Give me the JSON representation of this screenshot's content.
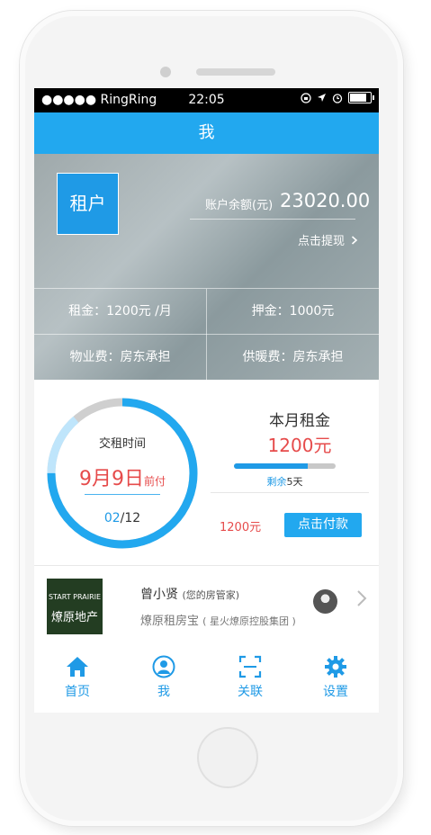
{
  "status_bar": {
    "carrier": "●●●●● RingRing",
    "time": "22:05"
  },
  "nav": {
    "title": "我"
  },
  "account": {
    "role": "租户",
    "balance_label": "账户余额(元)",
    "balance_value": "23020.00",
    "withdraw_label": "点击提现"
  },
  "fees": {
    "rent": "租金：1200元 /月",
    "deposit": "押金：1000元",
    "property": "物业费：房东承担",
    "heating": "供暖费：房东承担"
  },
  "payment_ring": {
    "title": "交租时间",
    "date": "9月9日",
    "date_suffix": "前付",
    "current": "02",
    "total": "/12",
    "progress_fraction": 0.75
  },
  "monthly_rent": {
    "title": "本月租金",
    "amount": "1200元",
    "remaining_prefix": "剩余",
    "remaining_days": "5天",
    "bar_fraction": 0.73,
    "pay_amount": "1200元",
    "pay_button": "点击付款"
  },
  "manager": {
    "logo_line1": "START PRAIRIE",
    "logo_line2": "燎原地产",
    "name": "曾小贤",
    "name_note": "(您的房管家)",
    "company": "燎原租房宝",
    "company_note": "( 星火燎原控股集团 )"
  },
  "tabs": [
    {
      "label": "首页",
      "icon": "home-icon"
    },
    {
      "label": "我",
      "icon": "user-icon"
    },
    {
      "label": "关联",
      "icon": "scan-icon"
    },
    {
      "label": "设置",
      "icon": "gear-icon"
    }
  ],
  "colors": {
    "accent": "#22a8ef",
    "red": "#e64b4b"
  }
}
